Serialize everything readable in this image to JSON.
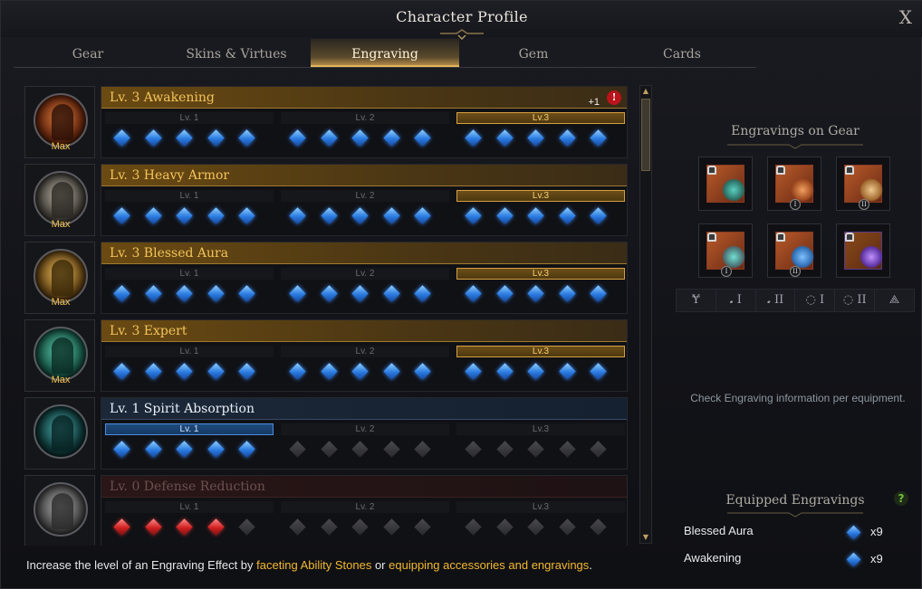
{
  "window": {
    "title": "Character Profile",
    "close_label": "X"
  },
  "tabs": [
    {
      "label": "Gear"
    },
    {
      "label": "Skins & Virtues"
    },
    {
      "label": "Engraving"
    },
    {
      "label": "Gem"
    },
    {
      "label": "Cards"
    }
  ],
  "active_tab": "Engraving",
  "engravings": [
    {
      "name": "Lv. 3 Awakening",
      "state": "gold",
      "badge": "Max",
      "plus": "+1",
      "warn": "!",
      "levels": [
        "Lv. 1",
        "Lv. 2",
        "Lv.3"
      ],
      "active_level": 3,
      "gems": [
        "blue",
        "blue",
        "blue",
        "blue",
        "blue",
        "blue",
        "blue",
        "blue",
        "blue",
        "blue",
        "blue",
        "blue",
        "blue",
        "blue",
        "blue"
      ]
    },
    {
      "name": "Lv. 3 Heavy Armor",
      "state": "gold",
      "badge": "Max",
      "levels": [
        "Lv. 1",
        "Lv. 2",
        "Lv.3"
      ],
      "active_level": 3,
      "gems": [
        "blue",
        "blue",
        "blue",
        "blue",
        "blue",
        "blue",
        "blue",
        "blue",
        "blue",
        "blue",
        "blue",
        "blue",
        "blue",
        "blue",
        "blue"
      ]
    },
    {
      "name": "Lv. 3 Blessed Aura",
      "state": "gold",
      "badge": "Max",
      "levels": [
        "Lv. 1",
        "Lv. 2",
        "Lv.3"
      ],
      "active_level": 3,
      "gems": [
        "blue",
        "blue",
        "blue",
        "blue",
        "blue",
        "blue",
        "blue",
        "blue",
        "blue",
        "blue",
        "blue",
        "blue",
        "blue",
        "blue",
        "blue"
      ]
    },
    {
      "name": "Lv. 3 Expert",
      "state": "gold",
      "badge": "Max",
      "levels": [
        "Lv. 1",
        "Lv. 2",
        "Lv.3"
      ],
      "active_level": 3,
      "gems": [
        "blue",
        "blue",
        "blue",
        "blue",
        "blue",
        "blue",
        "blue",
        "blue",
        "blue",
        "blue",
        "blue",
        "blue",
        "blue",
        "blue",
        "blue"
      ]
    },
    {
      "name": "Lv. 1 Spirit Absorption",
      "state": "blue",
      "badge": "",
      "levels": [
        "Lv. 1",
        "Lv. 2",
        "Lv.3"
      ],
      "active_level": 1,
      "gems": [
        "blue",
        "blue",
        "blue",
        "blue",
        "blue",
        "empty",
        "empty",
        "empty",
        "empty",
        "empty",
        "empty",
        "empty",
        "empty",
        "empty",
        "empty"
      ]
    },
    {
      "name": "Lv. 0 Defense Reduction",
      "state": "dim",
      "badge": "",
      "levels": [
        "Lv. 1",
        "Lv. 2",
        "Lv.3"
      ],
      "active_level": 0,
      "gems": [
        "red",
        "red",
        "red",
        "red",
        "empty",
        "empty",
        "empty",
        "empty",
        "empty",
        "empty",
        "empty",
        "empty",
        "empty",
        "empty",
        "empty"
      ]
    }
  ],
  "side": {
    "gear_heading": "Engravings on Gear",
    "gear_slots": [
      {
        "name": "necklace",
        "roman": ""
      },
      {
        "name": "earring",
        "roman": "I"
      },
      {
        "name": "earring",
        "roman": "II"
      },
      {
        "name": "ring",
        "roman": "I"
      },
      {
        "name": "ring",
        "roman": "II"
      },
      {
        "name": "ability-stone",
        "roman": ""
      }
    ],
    "type_tabs": [
      "Ɏ",
      "𝅘 I",
      "𝅘 II",
      "◌ I",
      "◌ II",
      "⟁"
    ],
    "check_text": "Check Engraving information per equipment.",
    "equipped_heading": "Equipped Engravings",
    "help": "?",
    "equipped": [
      {
        "name": "Blessed Aura",
        "count": "x9"
      },
      {
        "name": "Awakening",
        "count": "x9"
      }
    ]
  },
  "footer": {
    "prefix": "Increase the level of an Engraving Effect by ",
    "link1": "faceting Ability Stones",
    "mid": " or ",
    "link2": "equipping accessories and engravings",
    "suffix": "."
  },
  "colors": {
    "gold": "#f4c45a",
    "accent": "#f2b830",
    "gem_blue": "#2a7ae0",
    "gem_red": "#d02020"
  }
}
